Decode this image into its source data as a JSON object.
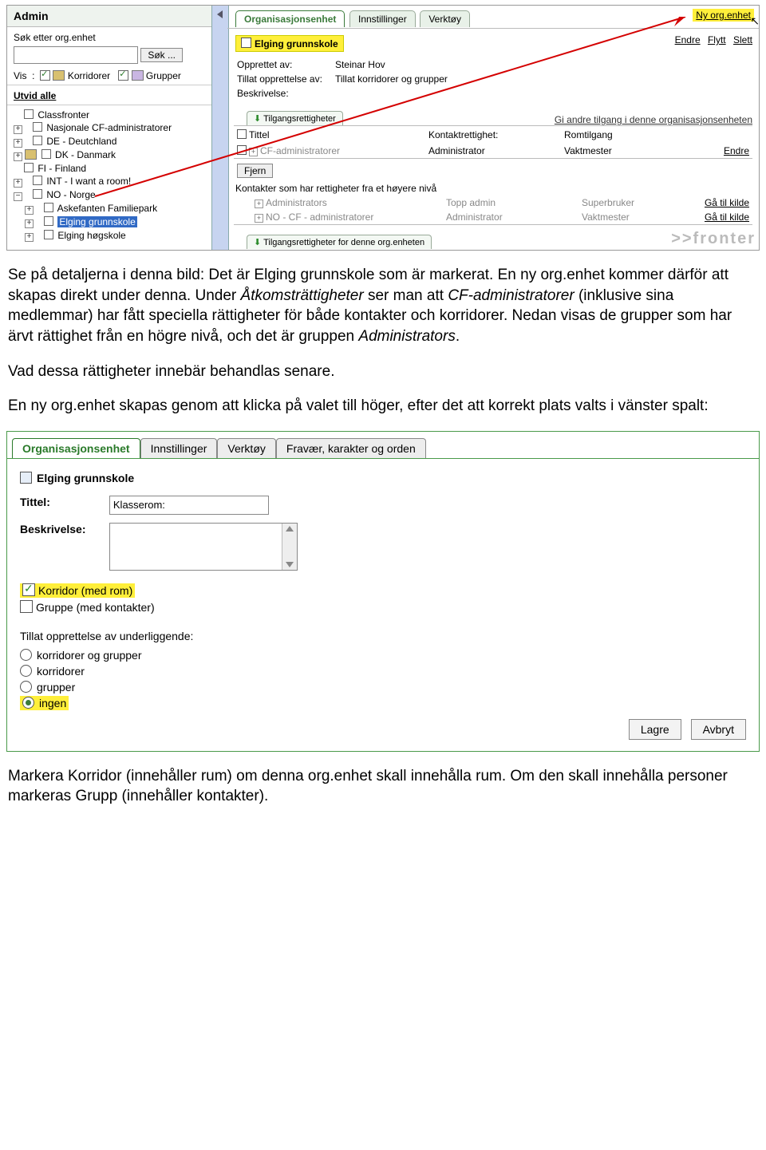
{
  "ss1": {
    "left": {
      "title": "Admin",
      "search_label": "Søk etter org.enhet",
      "search_btn": "Søk ...",
      "vis_label": "Vis",
      "korridorer": "Korridorer",
      "grupper": "Grupper",
      "utvid_alle": "Utvid alle",
      "tree": [
        {
          "exp": "",
          "label": "Classfronter"
        },
        {
          "exp": "+",
          "label": "Nasjonale CF-administratorer"
        },
        {
          "exp": "+",
          "label": "DE - Deutchland"
        },
        {
          "exp": "+",
          "label": "DK - Danmark",
          "icon": true
        },
        {
          "exp": "",
          "label": "FI - Finland"
        },
        {
          "exp": "+",
          "label": "INT - I want a room!"
        },
        {
          "exp": "-",
          "label": "NO - Norge"
        }
      ],
      "subtree": [
        {
          "exp": "+",
          "label": "Askefanten Familiepark"
        },
        {
          "exp": "+",
          "label": "Elging grunnskole",
          "sel": true
        },
        {
          "exp": "+",
          "label": "Elging høgskole"
        }
      ]
    },
    "right": {
      "tabs": [
        "Organisasjonsenhet",
        "Innstillinger",
        "Verktøy"
      ],
      "newlink": "Ny org.enhet",
      "actions": [
        "Endre",
        "Flytt",
        "Slett"
      ],
      "org_name": "Elging grunnskole",
      "meta": {
        "opprettet_label": "Opprettet av:",
        "opprettet_val": "Steinar Hov",
        "tillat_label": "Tillat opprettelse av:",
        "tillat_val": "Tillat korridorer og grupper",
        "beskr_label": "Beskrivelse:"
      },
      "subtab": "Tilgangsrettigheter",
      "gi_andre": "Gi andre tilgang i denne organisasjonsenheten",
      "hdr": {
        "tittel": "Tittel",
        "kontakt": "Kontaktrettighet:",
        "rom": "Romtilgang"
      },
      "row1": {
        "name": "CF-administratorer",
        "k": "Administrator",
        "r": "Vaktmester",
        "link": "Endre"
      },
      "fjern": "Fjern",
      "kontakter_title": "Kontakter som har rettigheter fra et høyere nivå",
      "rows": [
        {
          "name": "Administrators",
          "k": "Topp admin",
          "r": "Superbruker",
          "link": "Gå til kilde"
        },
        {
          "name": "NO - CF - administratorer",
          "k": "Administrator",
          "r": "Vaktmester",
          "link": "Gå til kilde"
        }
      ],
      "subtab2": "Tilgangsrettigheter for denne org.enheten"
    }
  },
  "body": {
    "p1": "Se på detaljerna i denna bild: Det är Elging grunnskole som är markerat. En ny org.enhet kommer därför att skapas direkt under denna.",
    "p2a": "Under ",
    "p2b": "Åtkomsträttigheter",
    "p2c": " ser man att ",
    "p2d": "CF-administratorer",
    "p2e": " (inklusive sina medlemmar) har fått speciella rättigheter för både kontakter och korridorer. Nedan visas de grupper som har ärvt rättighet från en högre nivå, och det är gruppen ",
    "p2f": "Administrators",
    "p2g": ".",
    "p3": "Vad dessa rättigheter innebär behandlas senare.",
    "p4": "En ny org.enhet skapas genom att klicka på valet till höger, efter det att korrekt plats valts i vänster spalt:",
    "p5": "Markera Korridor (innehåller rum) om denna org.enhet skall innehålla rum. Om den skall innehålla personer markeras Grupp (innehåller kontakter)."
  },
  "ss2": {
    "tabs": [
      "Organisasjonsenhet",
      "Innstillinger",
      "Verktøy",
      "Fravær, karakter og orden"
    ],
    "heading": "Elging grunnskole",
    "tittel_label": "Tittel:",
    "tittel_val": "Klasserom:",
    "beskr_label": "Beskrivelse:",
    "korridor": "Korridor (med rom)",
    "gruppe": "Gruppe (med kontakter)",
    "tillat": "Tillat opprettelse av underliggende:",
    "opts": [
      "korridorer og grupper",
      "korridorer",
      "grupper",
      "ingen"
    ],
    "lagre": "Lagre",
    "avbryt": "Avbryt"
  }
}
